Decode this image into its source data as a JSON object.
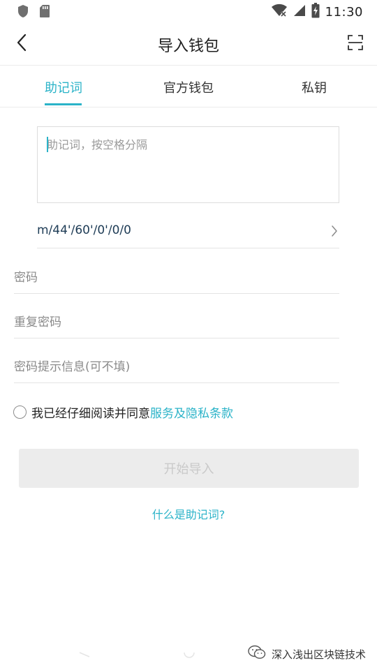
{
  "status_bar": {
    "time": "11:30",
    "icons": [
      "shield-icon",
      "sd-card-icon",
      "wifi-icon",
      "signal-icon",
      "battery-charging-icon"
    ]
  },
  "nav": {
    "title": "导入钱包",
    "back_icon": "chevron-left-icon",
    "scan_icon": "scan-icon"
  },
  "tabs": [
    {
      "label": "助记词",
      "active": true
    },
    {
      "label": "官方钱包",
      "active": false
    },
    {
      "label": "私钥",
      "active": false
    }
  ],
  "colors": {
    "accent": "#2bb3c8",
    "path_text": "#1d3b55",
    "disabled_button_bg": "#ececec",
    "disabled_button_text": "#c9c9c9"
  },
  "form": {
    "mnemonic_placeholder": "助记词，按空格分隔",
    "derivation_path": "m/44'/60'/0'/0/0",
    "password_placeholder": "密码",
    "repeat_password_placeholder": "重复密码",
    "hint_placeholder": "密码提示信息(可不填)"
  },
  "agreement": {
    "text": "我已经仔细阅读并同意",
    "link": "服务及隐私条款",
    "checked": false
  },
  "start_button": "开始导入",
  "help_link": "什么是助记词?",
  "watermark": "深入浅出区块链技术"
}
